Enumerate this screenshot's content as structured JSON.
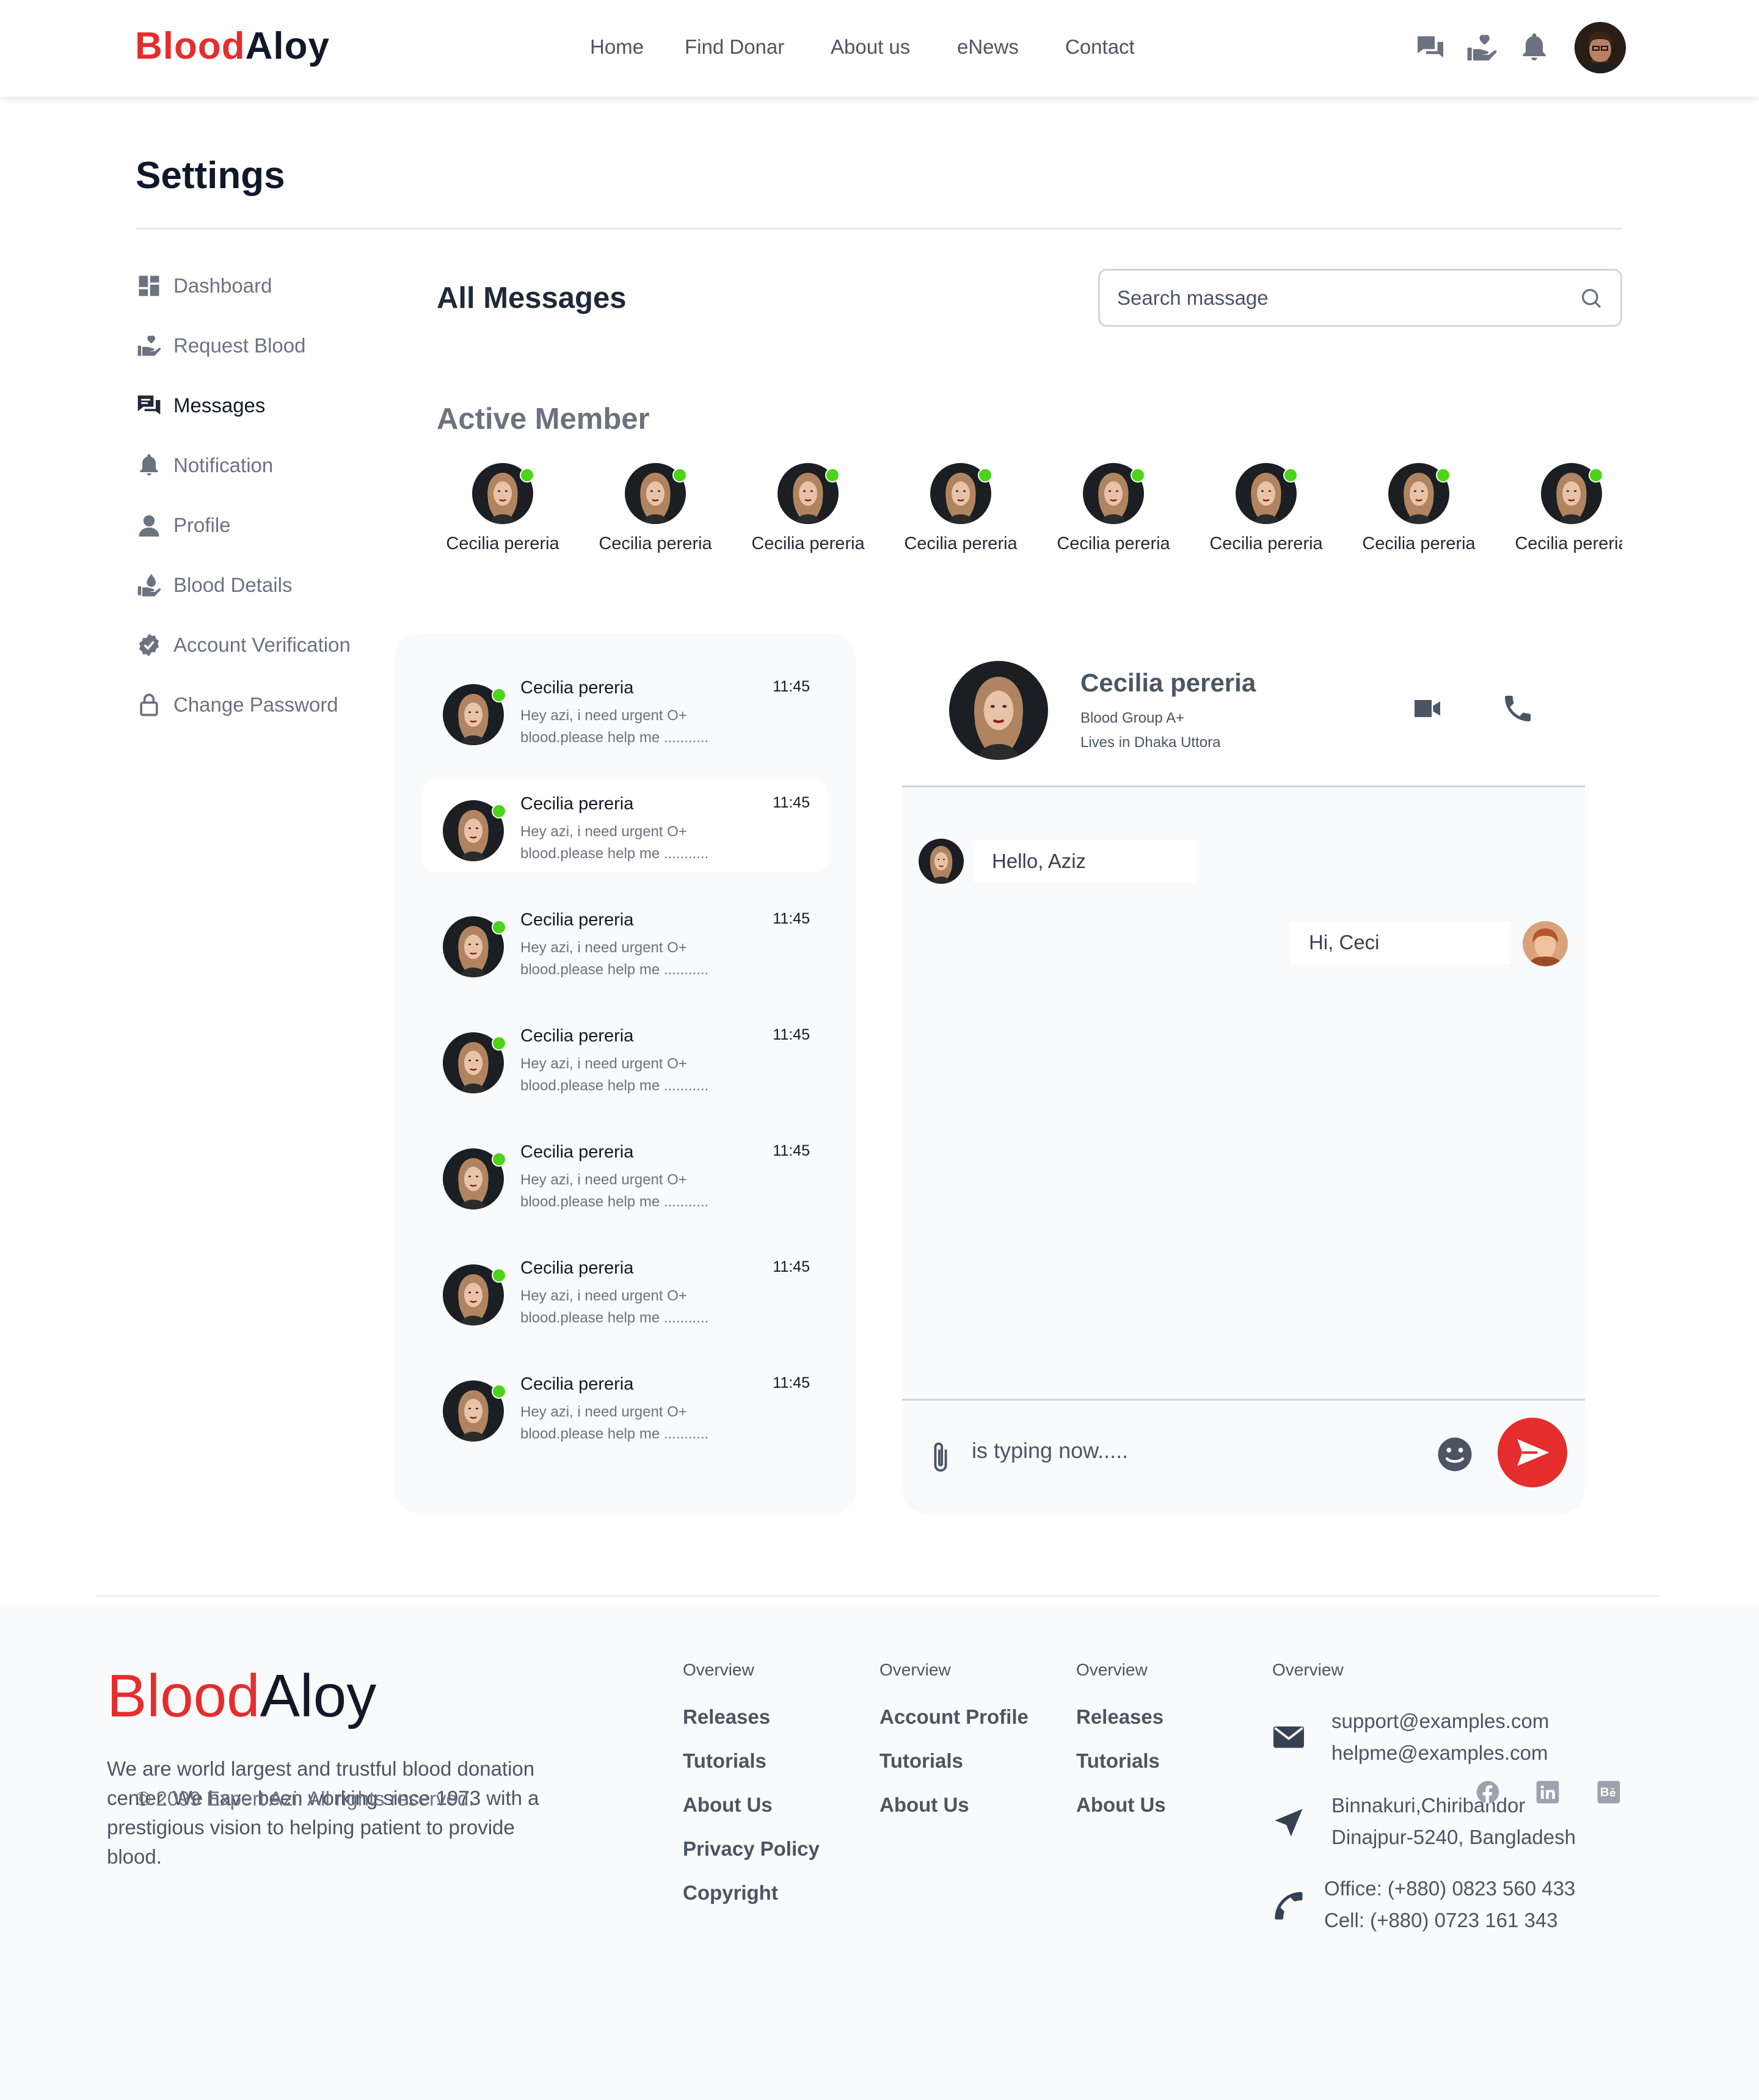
{
  "header": {
    "logo_part1": "Blood",
    "logo_part2": "Aloy",
    "nav": [
      "Home",
      "Find Donar",
      "About us",
      "eNews",
      "Contact"
    ],
    "icons": [
      "chat-icon",
      "donation-icon",
      "bell-icon",
      "user-avatar"
    ]
  },
  "settings": {
    "title": "Settings",
    "sidebar": [
      {
        "label": "Dashboard",
        "icon": "dashboard-icon"
      },
      {
        "label": "Request Blood",
        "icon": "hand-heart-icon"
      },
      {
        "label": "Messages",
        "icon": "messages-icon",
        "active": true
      },
      {
        "label": "Notification",
        "icon": "bell-icon"
      },
      {
        "label": "Profile",
        "icon": "user-icon"
      },
      {
        "label": "Blood Details",
        "icon": "blood-drop-icon"
      },
      {
        "label": "Account Verification",
        "icon": "verified-icon"
      },
      {
        "label": "Change Password",
        "icon": "lock-icon"
      }
    ]
  },
  "messages": {
    "title": "All Messages",
    "search_placeholder": "Search massage",
    "active_title": "Active Member",
    "active_members": [
      "Cecilia pereria",
      "Cecilia pereria",
      "Cecilia pereria",
      "Cecilia pereria",
      "Cecilia pereria",
      "Cecilia pereria",
      "Cecilia pereria",
      "Cecilia pereria"
    ],
    "list": [
      {
        "name": "Cecilia pereria",
        "time": "11:45",
        "preview": "Hey azi, i need urgent O+ blood.please help me ..........."
      },
      {
        "name": "Cecilia pereria",
        "time": "11:45",
        "preview": "Hey azi, i need urgent O+ blood.please help me ...........",
        "selected": true
      },
      {
        "name": "Cecilia pereria",
        "time": "11:45",
        "preview": "Hey azi, i need urgent O+ blood.please help me ..........."
      },
      {
        "name": "Cecilia pereria",
        "time": "11:45",
        "preview": "Hey azi, i need urgent O+ blood.please help me ..........."
      },
      {
        "name": "Cecilia pereria",
        "time": "11:45",
        "preview": "Hey azi, i need urgent O+ blood.please help me ..........."
      },
      {
        "name": "Cecilia pereria",
        "time": "11:45",
        "preview": "Hey azi, i need urgent O+ blood.please help me ..........."
      },
      {
        "name": "Cecilia pereria",
        "time": "11:45",
        "preview": "Hey azi, i need urgent O+ blood.please help me ..........."
      }
    ]
  },
  "chat": {
    "name": "Cecilia pereria",
    "blood_group": "Blood Group A+",
    "lives": "Lives in Dhaka Uttora",
    "incoming": "Hello, Aziz",
    "outgoing": "Hi, Ceci",
    "typing_placeholder": "is typing now....."
  },
  "footer": {
    "logo_part1": "Blood",
    "logo_part2": "Aloy",
    "description": "We are world largest and trustful blood donation center. We have been working since 1973 with a prestigious vision to helping patient to provide blood.",
    "col1": {
      "heading": "Overview",
      "links": [
        "Releases",
        "Tutorials",
        "About Us",
        "Privacy Policy",
        "Copyright"
      ]
    },
    "col2": {
      "heading": "Overview",
      "links": [
        "Account Profile",
        "Tutorials",
        "About Us"
      ]
    },
    "col3": {
      "heading": "Overview",
      "links": [
        "Releases",
        "Tutorials",
        "About Us"
      ]
    },
    "col4": {
      "heading": "Overview",
      "email1": "support@examples.com",
      "email2": "helpme@examples.com",
      "address1": "Binnakuri,Chiribandor",
      "address2": "Dinajpur-5240, Bangladesh",
      "phone1": "Office: (+880) 0823 560 433",
      "phone2": "Cell: (+880) 0723 161 343"
    },
    "copyright": "© 2099 Expert Azi. All rights reserved.",
    "social": [
      "facebook-icon",
      "linkedin-icon",
      "behance-icon"
    ]
  },
  "colors": {
    "brand_red": "#e52d2d",
    "online_green": "#4cd418",
    "text_gray": "#6b7280"
  }
}
